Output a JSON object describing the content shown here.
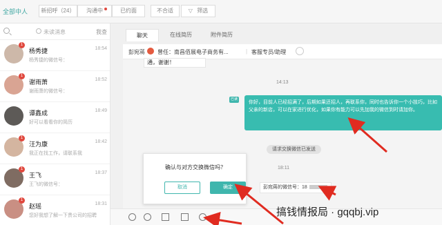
{
  "topbar": {
    "all_label": "全部中人",
    "filters": [
      "新招呼（24）",
      "沟通中",
      "已约面",
      "不合适",
      "筛选"
    ]
  },
  "list": {
    "unread_label": "未读消息",
    "mine_label": "我查",
    "items": [
      {
        "name": "杨秀捷",
        "time": "18:54",
        "preview": "杨秀捷的微信号：",
        "badge": "1",
        "avatar_color": "#cdb8a9"
      },
      {
        "name": "谢雨萧",
        "time": "18:52",
        "preview": "谢雨萧的微信号：",
        "badge": "1",
        "avatar_color": "#d9a493"
      },
      {
        "name": "谭鑫成",
        "time": "18:49",
        "preview": "好可以看看你的简历",
        "badge": "",
        "avatar_color": "#5d5a57"
      },
      {
        "name": "汪为康",
        "time": "18:42",
        "preview": "我正在找工作，请联系我",
        "badge": "1",
        "avatar_color": "#d4b5a0"
      },
      {
        "name": "王飞",
        "time": "18:37",
        "preview": "王飞的微信号：",
        "badge": "1",
        "avatar_color": "#7f6c62"
      },
      {
        "name": "赵瑶",
        "time": "18:31",
        "preview": "您好我想了解一下贵公司的招聘",
        "badge": "1",
        "avatar_color": "#c98f83"
      }
    ]
  },
  "chat": {
    "tabs": [
      "聊天",
      "在线简历",
      "附件简历"
    ],
    "info": {
      "name": "彭宛蒋",
      "prev_company": "曾任：南昌佰展电子商务有...",
      "divider": "|",
      "job": "客服专员/助理"
    },
    "top_bubble": "通，谢谢！",
    "time1": "14:13",
    "tag": "已读",
    "green_message": "你好，目前人已经招满了，后期如果还招人，再联系你，同时也告诉你一个小技巧，比如父亲的新店，可以在家进行优化，如果你有能力可以先加我的微信到时请加你。",
    "system_message": "请求交换微信已发送",
    "time2": "18:11",
    "wechat_prefix": "彭宛蒋的微信号：18"
  },
  "dialog": {
    "text": "确认与对方交换微信吗？",
    "cancel": "取消",
    "ok": "确定"
  },
  "watermark": "搞钱情报局 · gqqbj.vip",
  "colors": {
    "accent": "#3fb6ad",
    "badge": "#e0483e",
    "arrow": "#e02b20"
  }
}
